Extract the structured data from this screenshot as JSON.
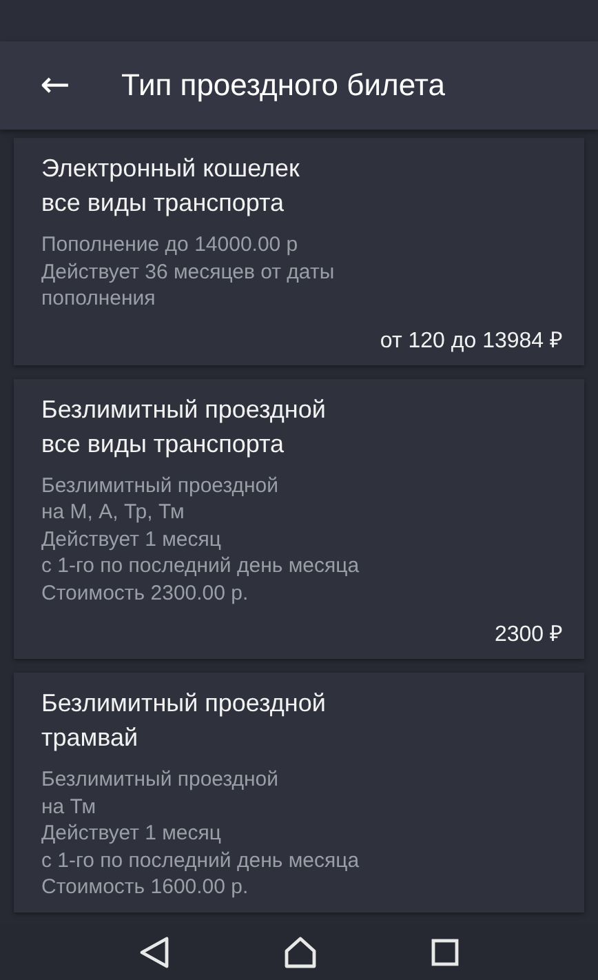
{
  "app_bar": {
    "back": "←",
    "title": "Тип проездного билета"
  },
  "cards": [
    {
      "title": "Электронный кошелек\nвсе виды транспорта",
      "description": "Пополнение до 14000.00 р\nДействует 36 месяцев от даты\nпополнения",
      "price": "от 120 до 13984 ₽"
    },
    {
      "title": "Безлимитный проездной\nвсе виды транспорта",
      "description": "Безлимитный проездной\nна М, А, Тр, Тм\nДействует 1 месяц\nс 1-го по последний день месяца\nСтоимость 2300.00 р.",
      "price": "2300 ₽"
    },
    {
      "title": "Безлимитный проездной\nтрамвай",
      "description": "Безлимитный проездной\nна Тм\nДействует 1 месяц\nс 1-го по последний день месяца\nСтоимость 1600.00 р."
    }
  ]
}
